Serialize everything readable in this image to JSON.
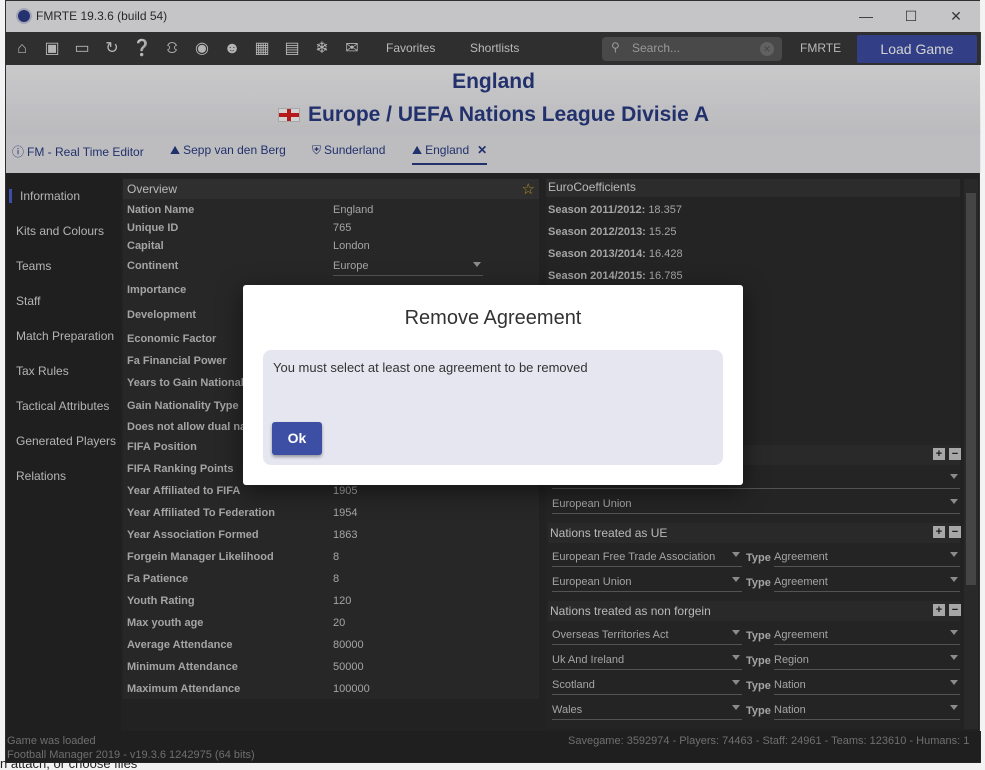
{
  "window": {
    "title": "FMRTE 19.3.6 (build 54)"
  },
  "toolbar": {
    "favorites": "Favorites",
    "shortlists": "Shortlists",
    "search_placeholder": "Search...",
    "brand": "FMRTE",
    "load_game": "Load Game",
    "icons": [
      "home-icon",
      "save-icon",
      "monitor-icon",
      "refresh-icon",
      "help-icon",
      "person-run-icon",
      "binoculars-icon",
      "people-icon",
      "calendar-icon",
      "document-icon",
      "snowflake-icon",
      "mail-icon"
    ]
  },
  "header": {
    "title": "England",
    "competition": "Europe / UEFA Nations League Divisie A"
  },
  "tabs": [
    {
      "label": "FM - Real Time Editor",
      "icon": "help-circle-icon"
    },
    {
      "label": "Sepp van den Berg",
      "icon": "player-icon"
    },
    {
      "label": "Sunderland",
      "icon": "shield-icon"
    },
    {
      "label": "England",
      "icon": "player-icon",
      "active": true
    }
  ],
  "sidebar": {
    "items": [
      "Information",
      "Kits and Colours",
      "Teams",
      "Staff",
      "Match Preparation",
      "Tax Rules",
      "Tactical Attributes",
      "Generated Players",
      "Relations"
    ]
  },
  "overview": {
    "heading": "Overview",
    "rows": [
      {
        "label": "Nation Name",
        "value": "England"
      },
      {
        "label": "Unique ID",
        "value": "765"
      },
      {
        "label": "Capital",
        "value": "London"
      },
      {
        "label": "Continent",
        "value": "Europe"
      },
      {
        "label": "Importance",
        "value": ""
      },
      {
        "label": "Development",
        "value": ""
      },
      {
        "label": "Economic Factor",
        "value": ""
      },
      {
        "label": "Fa Financial Power",
        "value": ""
      },
      {
        "label": "Years to Gain Nationali",
        "value": ""
      },
      {
        "label": "Gain Nationality Type",
        "value": ""
      },
      {
        "label": "Does not allow dual na",
        "value": ""
      },
      {
        "label": "FIFA Position",
        "value": ""
      },
      {
        "label": "FIFA Ranking Points",
        "value": ""
      },
      {
        "label": "Year Affiliated to FIFA",
        "value": "1905"
      },
      {
        "label": "Year Affiliated To Federation",
        "value": "1954"
      },
      {
        "label": "Year Association Formed",
        "value": "1863"
      },
      {
        "label": "Forgein Manager Likelihood",
        "value": "8"
      },
      {
        "label": "Fa Patience",
        "value": "8"
      },
      {
        "label": "Youth Rating",
        "value": "120"
      },
      {
        "label": "Max youth age",
        "value": "20"
      },
      {
        "label": "Average Attendance",
        "value": "80000"
      },
      {
        "label": "Minimum Attendance",
        "value": "50000"
      },
      {
        "label": "Maximum Attendance",
        "value": "100000"
      }
    ]
  },
  "euro": {
    "heading": "EuroCoefficients",
    "seasons": [
      {
        "label": "Season 2011/2012:",
        "value": "18.357"
      },
      {
        "label": "Season 2012/2013:",
        "value": "15.25"
      },
      {
        "label": "Season 2013/2014:",
        "value": "16.428"
      },
      {
        "label": "Season 2014/2015:",
        "value": "16.785"
      }
    ]
  },
  "unions": {
    "first_value": "",
    "second_value": "European Union"
  },
  "treated_ue": {
    "heading": "Nations treated as UE",
    "type_label": "Type",
    "rows": [
      {
        "name": "European Free Trade Association",
        "type": "Agreement"
      },
      {
        "name": "European Union",
        "type": "Agreement"
      }
    ]
  },
  "treated_non_foreign": {
    "heading": "Nations treated as non forgein",
    "type_label": "Type",
    "rows": [
      {
        "name": "Overseas Territories Act",
        "type": "Agreement"
      },
      {
        "name": "Uk And Ireland",
        "type": "Region"
      },
      {
        "name": "Scotland",
        "type": "Nation"
      },
      {
        "name": "Wales",
        "type": "Nation"
      }
    ]
  },
  "status": {
    "line1": "Game was loaded",
    "line2": "Football Manager 2019 - v19.3.6 1242975  (64 bits)",
    "right": "Savegame: 3592974 - Players: 74463 - Staff: 24961 - Teams: 123610 - Humans: 1"
  },
  "desktop": {
    "bottom_hint": "n attach, or choose files"
  },
  "dialog": {
    "title": "Remove Agreement",
    "message": "You must select at least one agreement to be removed",
    "ok": "Ok"
  }
}
